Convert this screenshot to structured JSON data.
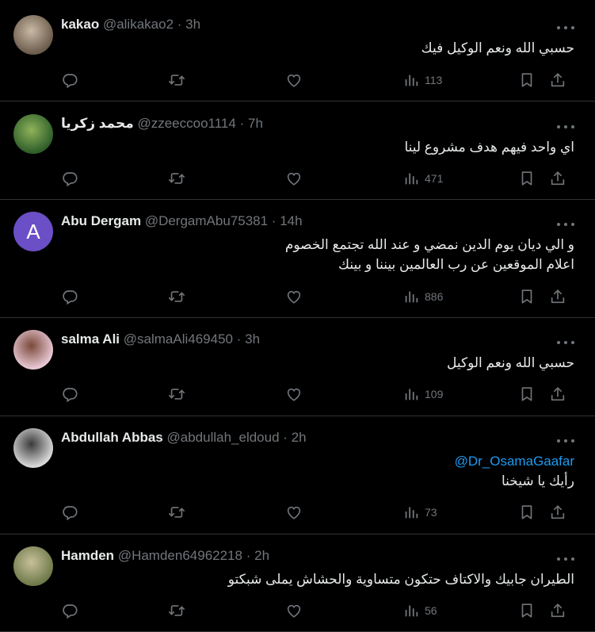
{
  "tweets": [
    {
      "name": "kakao",
      "handle": "@alikakao2",
      "dot": "·",
      "time": "3h",
      "avatar": "photo",
      "avatar_colors": [
        "#6b5c4c",
        "#c9b9a5"
      ],
      "lines": [
        "حسبي الله ونعم الوكيل فيك"
      ],
      "mention": "",
      "views": "113"
    },
    {
      "name": "محمد زكريا",
      "handle": "@zzeeccoo1114",
      "dot": "·",
      "time": "7h",
      "avatar": "photo",
      "avatar_colors": [
        "#2f5f2a",
        "#8fb35a"
      ],
      "lines": [
        "اي واحد فيهم هدف مشروع لينا"
      ],
      "mention": "",
      "views": "471"
    },
    {
      "name": "Abu Dergam",
      "handle": "@DergamAbu75381",
      "dot": "·",
      "time": "14h",
      "avatar": "letter",
      "avatar_letter": "A",
      "lines": [
        "و الي ديان يوم الدين نمضي و عند الله تجتمع الخصوم",
        "اعلام الموقعين عن رب العالمين بيننا و بينك"
      ],
      "mention": "",
      "views": "886"
    },
    {
      "name": "salma Ali",
      "handle": "@salmaAli469450",
      "dot": "·",
      "time": "3h",
      "avatar": "photo",
      "avatar_colors": [
        "#e8c7d4",
        "#7a4a3a"
      ],
      "lines": [
        "حسبي الله ونعم الوكيل"
      ],
      "mention": "",
      "views": "109"
    },
    {
      "name": "Abdullah Abbas",
      "handle": "@abdullah_eldoud",
      "dot": "·",
      "time": "2h",
      "avatar": "photo",
      "avatar_colors": [
        "#d8d8d8",
        "#3a3a3a"
      ],
      "lines": [
        "رأيك يا شيخنا"
      ],
      "mention": "@Dr_OsamaGaafar",
      "views": "73"
    },
    {
      "name": "Hamden",
      "handle": "@Hamden64962218",
      "dot": "·",
      "time": "2h",
      "avatar": "photo",
      "avatar_colors": [
        "#6f7a4a",
        "#c8c09a"
      ],
      "lines": [
        "الطيران جابيك والاكتاف حتكون متساوية والحشاش يملى شبكتو"
      ],
      "mention": "",
      "views": "56"
    }
  ],
  "icons": {
    "reply": "reply-icon",
    "retweet": "retweet-icon",
    "like": "like-icon",
    "views": "views-icon",
    "bookmark": "bookmark-icon",
    "share": "share-icon",
    "more": "more-icon"
  },
  "colors": {
    "background": "#000000",
    "text": "#e7e9ea",
    "muted": "#71767b",
    "link": "#1d9bf0",
    "border": "#2f3336"
  }
}
